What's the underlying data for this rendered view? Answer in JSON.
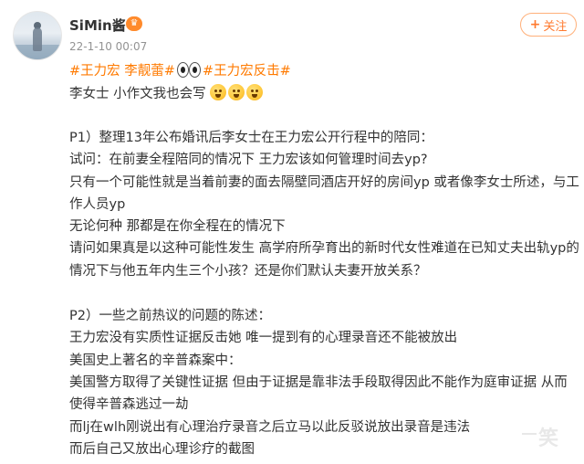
{
  "post": {
    "author": {
      "name": "SiMin酱-",
      "badge_icon": "vip-crown-icon"
    },
    "timestamp": "22-1-10 00:07",
    "follow_button": {
      "label": "关注",
      "icon": "plus-icon"
    },
    "tags": [
      "#王力宏 李靓蕾#",
      "#王力宏反击#"
    ],
    "intro": "李女士 小作文我也会写",
    "lines": [
      "P1）整理13年公布婚讯后李女士在王力宏公开行程中的陪同：",
      "试问：在前妻全程陪同的情况下 王力宏该如何管理时间去yp?",
      "只有一个可能性就是当着前妻的面去隔壁同酒店开好的房间yp 或者像李女士所述，与工",
      "作人员yp",
      "无论何种 那都是在你全程在的情况下",
      "请问如果真是以这种可能性发生 高学府所孕育出的新时代女性难道在已知丈夫出轨yp的",
      "情况下与他五年内生三个小孩？还是你们默认夫妻开放关系？",
      "P2）一些之前热议的问题的陈述：",
      "王力宏没有实质性证据反击她 唯一提到有的心理录音还不能被放出",
      "美国史上著名的辛普森案中：",
      "美国警方取得了关键性证据 但由于证据是靠非法手段取得因此不能作为庭审证据 从而",
      "使得辛普森逃过一劫",
      "而lj在wlh刚说出有心理治疗录音之后立马以此反驳说放出录音是违法",
      "而后自己又放出心理诊疗的截图"
    ]
  },
  "watermark": "笑",
  "colors": {
    "tag": "#ff7a00",
    "follow": "#ff7a2f"
  }
}
